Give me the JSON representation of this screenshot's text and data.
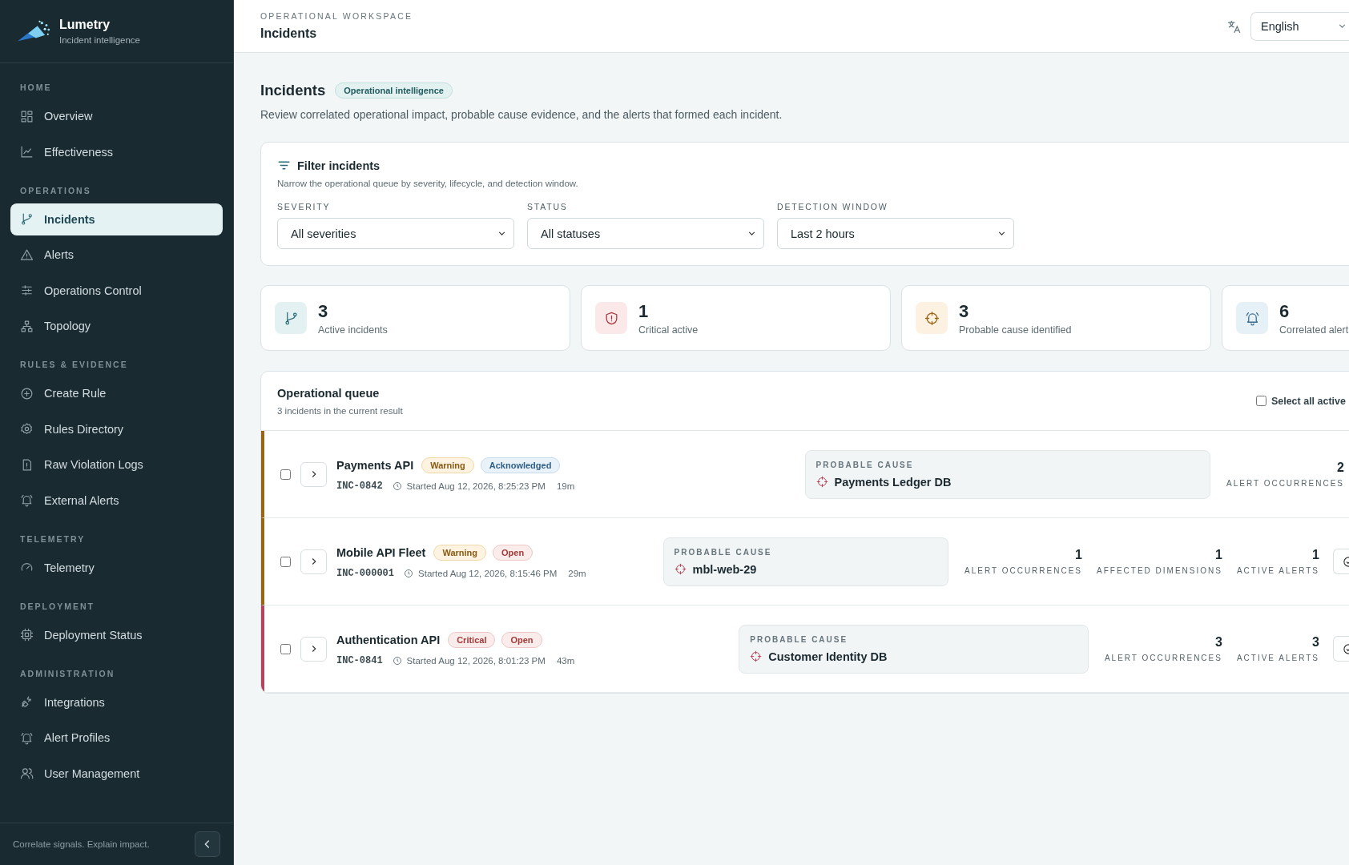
{
  "brand": {
    "name": "Lumetry",
    "tagline": "Incident intelligence"
  },
  "sidebar": {
    "sections": [
      {
        "title": "HOME",
        "items": [
          {
            "label": "Overview",
            "selected": false
          },
          {
            "label": "Effectiveness",
            "selected": false
          }
        ]
      },
      {
        "title": "OPERATIONS",
        "items": [
          {
            "label": "Incidents",
            "selected": true
          },
          {
            "label": "Alerts",
            "selected": false
          },
          {
            "label": "Operations Control",
            "selected": false
          },
          {
            "label": "Topology",
            "selected": false
          }
        ]
      },
      {
        "title": "RULES & EVIDENCE",
        "items": [
          {
            "label": "Create Rule",
            "selected": false
          },
          {
            "label": "Rules Directory",
            "selected": false
          },
          {
            "label": "Raw Violation Logs",
            "selected": false
          },
          {
            "label": "External Alerts",
            "selected": false
          }
        ]
      },
      {
        "title": "TELEMETRY",
        "items": [
          {
            "label": "Telemetry",
            "selected": false
          }
        ]
      },
      {
        "title": "DEPLOYMENT",
        "items": [
          {
            "label": "Deployment Status",
            "selected": false
          }
        ]
      },
      {
        "title": "ADMINISTRATION",
        "items": [
          {
            "label": "Integrations",
            "selected": false
          },
          {
            "label": "Alert Profiles",
            "selected": false
          },
          {
            "label": "User Management",
            "selected": false
          }
        ]
      }
    ],
    "footer": "Correlate signals. Explain impact."
  },
  "header": {
    "eyebrow": "OPERATIONAL WORKSPACE",
    "title": "Incidents",
    "language": "English"
  },
  "page": {
    "title": "Incidents",
    "badge": "Operational intelligence",
    "description": "Review correlated operational impact, probable cause evidence, and the alerts that formed each incident."
  },
  "filters": {
    "title": "Filter incidents",
    "subtitle": "Narrow the operational queue by severity, lifecycle, and detection window.",
    "fields": [
      {
        "label": "SEVERITY",
        "value": "All severities"
      },
      {
        "label": "STATUS",
        "value": "All statuses"
      },
      {
        "label": "DETECTION WINDOW",
        "value": "Last 2 hours"
      }
    ]
  },
  "stats": [
    {
      "value": "3",
      "label": "Active incidents"
    },
    {
      "value": "1",
      "label": "Critical active"
    },
    {
      "value": "3",
      "label": "Probable cause identified"
    },
    {
      "value": "6",
      "label": "Correlated alert"
    }
  ],
  "queue": {
    "title": "Operational queue",
    "subtitle": "3 incidents in the current result",
    "select_all": {
      "label": "Select all active",
      "checked": false
    },
    "rows": [
      {
        "name": "Payments API",
        "badges": [
          {
            "text": "Warning",
            "kind": "warning"
          },
          {
            "text": "Acknowledged",
            "kind": "acknowledged"
          }
        ],
        "id": "INC-0842",
        "started": "Started Aug 12, 2026, 8:25:23 PM",
        "age": "19m",
        "cause_label": "PROBABLE CAUSE",
        "cause": "Payments Ledger DB",
        "metrics": [
          {
            "value": "2",
            "label": "ALERT OCCURRENCES"
          }
        ],
        "checked": false,
        "action": false
      },
      {
        "name": "Mobile API Fleet",
        "badges": [
          {
            "text": "Warning",
            "kind": "warning"
          },
          {
            "text": "Open",
            "kind": "open"
          }
        ],
        "id": "INC-000001",
        "started": "Started Aug 12, 2026, 8:15:46 PM",
        "age": "29m",
        "cause_label": "PROBABLE CAUSE",
        "cause": "mbl-web-29",
        "metrics": [
          {
            "value": "1",
            "label": "ALERT OCCURRENCES"
          },
          {
            "value": "1",
            "label": "AFFECTED DIMENSIONS"
          },
          {
            "value": "1",
            "label": "ACTIVE ALERTS"
          }
        ],
        "checked": false,
        "action": true
      },
      {
        "name": "Authentication API",
        "badges": [
          {
            "text": "Critical",
            "kind": "critical"
          },
          {
            "text": "Open",
            "kind": "open"
          }
        ],
        "id": "INC-0841",
        "started": "Started Aug 12, 2026, 8:01:23 PM",
        "age": "43m",
        "cause_label": "PROBABLE CAUSE",
        "cause": "Customer Identity DB",
        "metrics": [
          {
            "value": "3",
            "label": "ALERT OCCURRENCES"
          },
          {
            "value": "3",
            "label": "ACTIVE ALERTS"
          }
        ],
        "checked": false,
        "action": true
      }
    ]
  }
}
